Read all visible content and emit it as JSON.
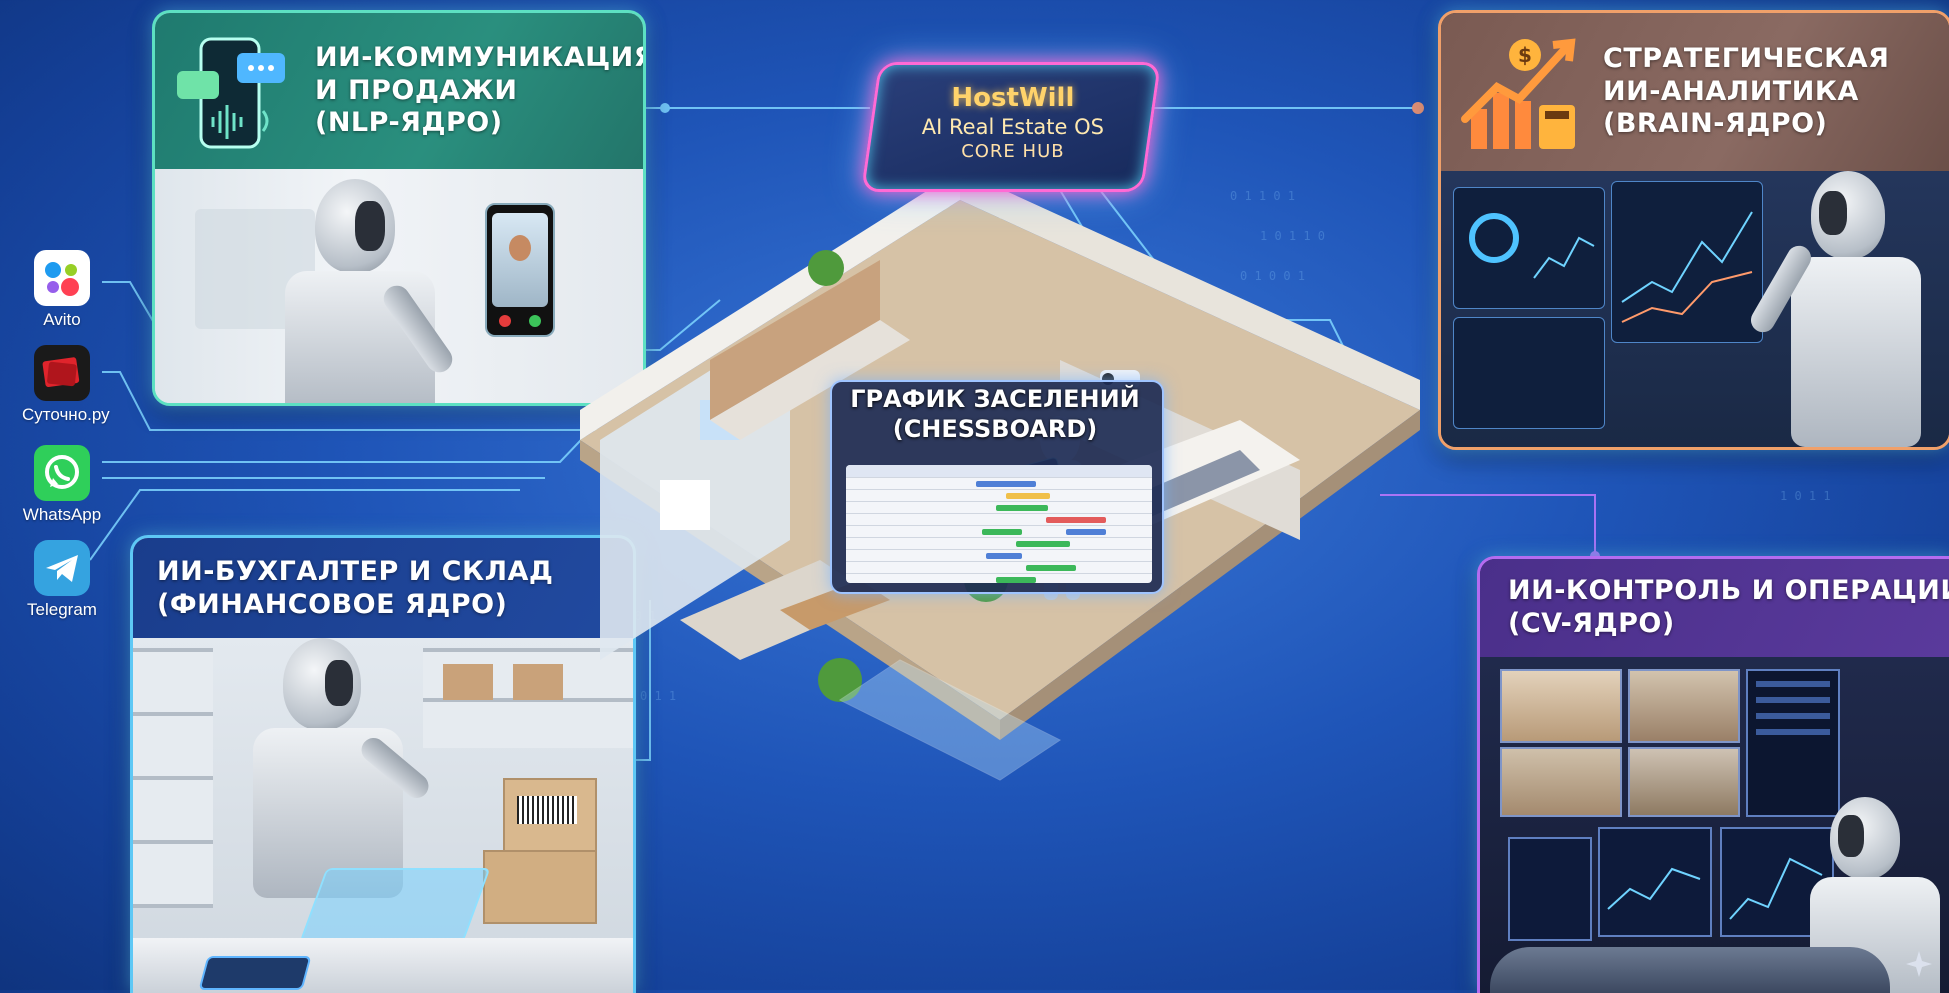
{
  "hub": {
    "name": "HostWill",
    "subtitle": "AI Real Estate OS",
    "label": "CORE HUB"
  },
  "panels": {
    "nlp": {
      "line1": "ИИ-КОММУНИКАЦИЯ",
      "line2": "И ПРОДАЖИ",
      "line3": "(NLP-ЯДРО)"
    },
    "brain": {
      "line1": "СТРАТЕГИЧЕСКАЯ",
      "line2": "ИИ-АНАЛИТИКА",
      "line3": "(BRAIN-ЯДРО)"
    },
    "finance": {
      "line1": "ИИ-БУХГАЛТЕР И СКЛАД",
      "line2": "(ФИНАНСОВОЕ ЯДРО)"
    },
    "cv": {
      "line1": "ИИ-КОНТРОЛЬ И ОПЕРАЦИИ",
      "line2": "(CV-ЯДРО)"
    }
  },
  "chessboard": {
    "line1": "ГРАФИК ЗАСЕЛЕНИЙ",
    "line2": "(CHESSBOARD)"
  },
  "channels": [
    {
      "label": "Avito",
      "icon": "avito-icon",
      "color": "#ffffff"
    },
    {
      "label": "Суточно.ру",
      "icon": "sutochno-icon",
      "color": "#e0242c"
    },
    {
      "label": "WhatsApp",
      "icon": "whatsapp-icon",
      "color": "#2fcf5a"
    },
    {
      "label": "Telegram",
      "icon": "telegram-icon",
      "color": "#35a3e0"
    }
  ],
  "colors": {
    "background": "#1f55b8",
    "nlp_border": "#5de0c2",
    "brain_border": "#f0a06a",
    "finance_border": "#5ec8f5",
    "cv_border": "#b46cf0",
    "hub_glow": "#ff5ad1",
    "circuit": "#7fd6ff"
  }
}
